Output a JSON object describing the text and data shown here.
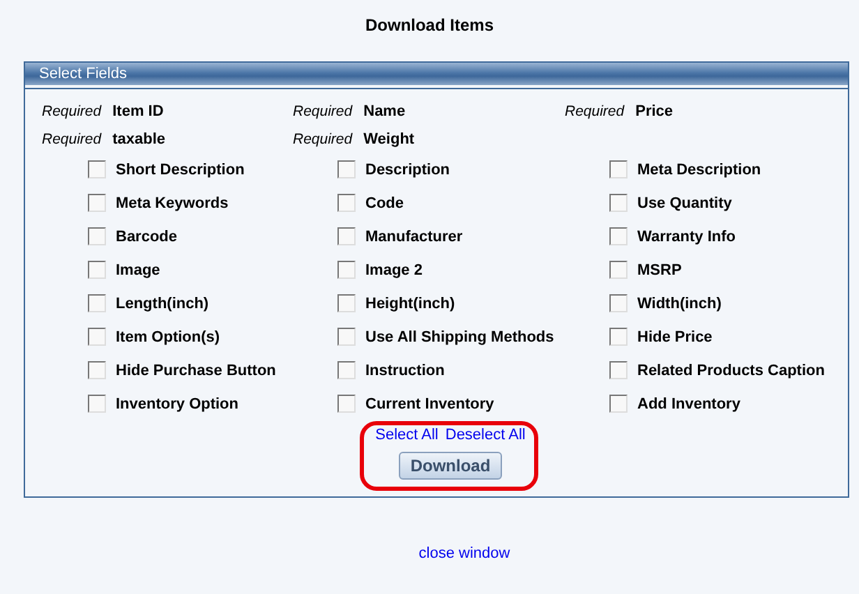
{
  "title": "Download Items",
  "panel": {
    "title": "Select Fields",
    "required": [
      {
        "tag": "Required",
        "name": "Item ID"
      },
      {
        "tag": "Required",
        "name": "Name"
      },
      {
        "tag": "Required",
        "name": "Price"
      },
      {
        "tag": "Required",
        "name": "taxable"
      },
      {
        "tag": "Required",
        "name": "Weight"
      }
    ],
    "fields": [
      {
        "label": "Short Description",
        "checked": false
      },
      {
        "label": "Description",
        "checked": false
      },
      {
        "label": "Meta Description",
        "checked": false
      },
      {
        "label": "Meta Keywords",
        "checked": false
      },
      {
        "label": "Code",
        "checked": false
      },
      {
        "label": "Use Quantity",
        "checked": false
      },
      {
        "label": "Barcode",
        "checked": false
      },
      {
        "label": "Manufacturer",
        "checked": false
      },
      {
        "label": "Warranty Info",
        "checked": false
      },
      {
        "label": "Image",
        "checked": false
      },
      {
        "label": "Image 2",
        "checked": false
      },
      {
        "label": "MSRP",
        "checked": false
      },
      {
        "label": "Length(inch)",
        "checked": false
      },
      {
        "label": "Height(inch)",
        "checked": false
      },
      {
        "label": "Width(inch)",
        "checked": false
      },
      {
        "label": "Item Option(s)",
        "checked": false
      },
      {
        "label": "Use All Shipping Methods",
        "checked": false
      },
      {
        "label": "Hide Price",
        "checked": false
      },
      {
        "label": "Hide Purchase Button",
        "checked": false
      },
      {
        "label": "Instruction",
        "checked": false
      },
      {
        "label": "Related Products Caption",
        "checked": false
      },
      {
        "label": "Inventory Option",
        "checked": false
      },
      {
        "label": "Current Inventory",
        "checked": false
      },
      {
        "label": "Add Inventory",
        "checked": false
      }
    ],
    "links": [
      "Select All",
      "Deselect All"
    ],
    "button": "Download"
  },
  "close_link": "close window"
}
